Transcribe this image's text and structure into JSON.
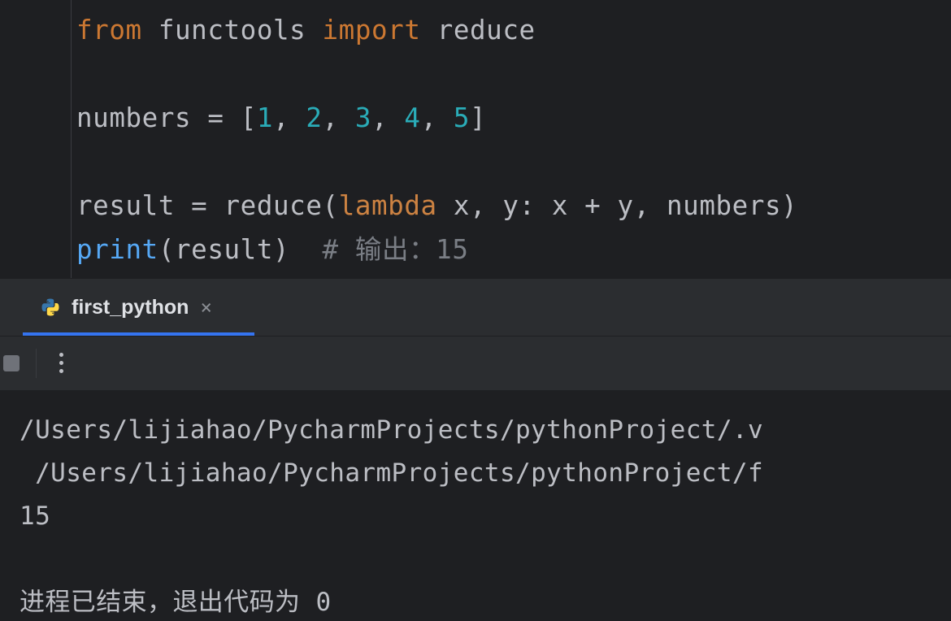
{
  "code": {
    "line1": {
      "from": "from",
      "mod": "functools",
      "import": "import",
      "name": "reduce"
    },
    "line3": {
      "var": "numbers",
      "eq": "=",
      "lb": "[",
      "n1": "1",
      "c1": ",",
      "n2": "2",
      "c2": ",",
      "n3": "3",
      "c3": ",",
      "n4": "4",
      "c4": ",",
      "n5": "5",
      "rb": "]"
    },
    "line5": {
      "var": "result",
      "eq": "=",
      "call": "reduce(",
      "lambda": "lambda",
      "lam_body": " x, y: x + y, numbers)"
    },
    "line6": {
      "print": "print",
      "arg": "(result)",
      "comment": "# 输出：15"
    }
  },
  "run_tab": {
    "label": "first_python",
    "close": "×"
  },
  "console": {
    "l1": "/Users/lijiahao/PycharmProjects/pythonProject/.v",
    "l2": " /Users/lijiahao/PycharmProjects/pythonProject/f",
    "l3": "15",
    "l4": "",
    "l5": "进程已结束，退出代码为 0"
  }
}
